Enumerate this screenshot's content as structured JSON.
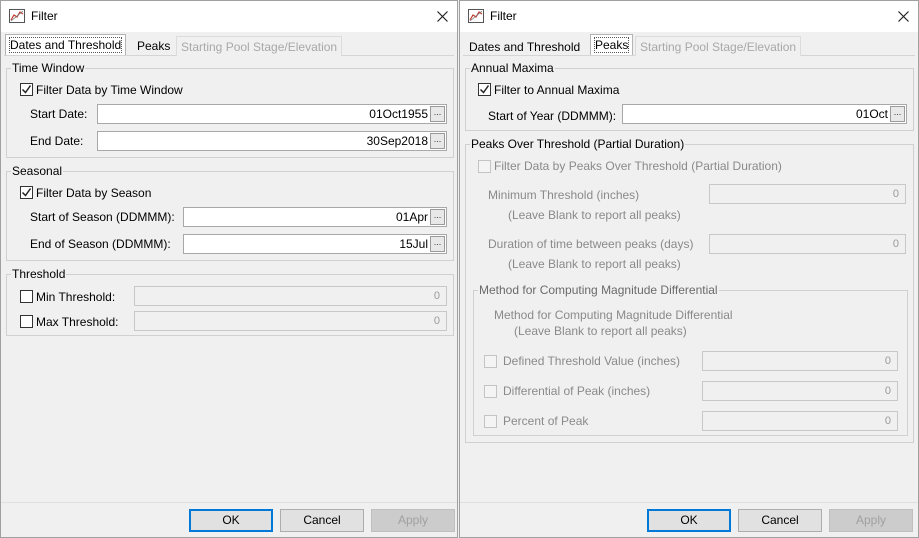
{
  "left_dialog": {
    "title": "Filter",
    "tabs": [
      "Dates and Threshold",
      "Peaks",
      "Starting Pool Stage/Elevation"
    ],
    "time_window": {
      "title": "Time Window",
      "checkbox_label": "Filter Data by Time Window",
      "checked": true,
      "start_label": "Start Date:",
      "start_value": "01Oct1955",
      "end_label": "End Date:",
      "end_value": "30Sep2018"
    },
    "seasonal": {
      "title": "Seasonal",
      "checkbox_label": "Filter Data by Season",
      "checked": true,
      "start_label": "Start of Season (DDMMM):",
      "start_value": "01Apr",
      "end_label": "End of Season (DDMMM):",
      "end_value": "15Jul"
    },
    "threshold": {
      "title": "Threshold",
      "min_label": "Min Threshold:",
      "min_value": "0",
      "max_label": "Max Threshold:",
      "max_value": "0"
    },
    "buttons": {
      "ok": "OK",
      "cancel": "Cancel",
      "apply": "Apply"
    }
  },
  "right_dialog": {
    "title": "Filter",
    "tabs": [
      "Dates and Threshold",
      "Peaks",
      "Starting Pool Stage/Elevation"
    ],
    "annual_maxima": {
      "title": "Annual Maxima",
      "checkbox_label": "Filter to Annual Maxima",
      "checked": true,
      "start_label": "Start of Year (DDMMM):",
      "start_value": "01Oct"
    },
    "pot": {
      "title": "Peaks Over Threshold (Partial Duration)",
      "checkbox_label": "Filter Data by Peaks Over Threshold (Partial Duration)",
      "min_label": "Minimum Threshold (inches)",
      "min_hint": "(Leave Blank to report all peaks)",
      "min_value": "0",
      "dur_label": "Duration of time between peaks (days)",
      "dur_hint": "(Leave Blank to report all peaks)",
      "dur_value": "0"
    },
    "method": {
      "title": "Method for Computing Magnitude Differential",
      "desc_line1": "Method for Computing Magnitude Differential",
      "desc_line2": "(Leave Blank to report all peaks)",
      "defined_label": "Defined Threshold Value (inches)",
      "defined_value": "0",
      "diff_label": "Differential of Peak (inches)",
      "diff_value": "0",
      "pct_label": "Percent of Peak",
      "pct_value": "0"
    },
    "buttons": {
      "ok": "OK",
      "cancel": "Cancel",
      "apply": "Apply"
    }
  },
  "icons": {
    "app": "filter-chart-icon",
    "close": "close-icon",
    "check": "check-icon",
    "ellipsis": "ellipsis-button-icon"
  },
  "colors": {
    "focus_border": "#0078d7",
    "disabled_text": "#a0a0a0"
  }
}
